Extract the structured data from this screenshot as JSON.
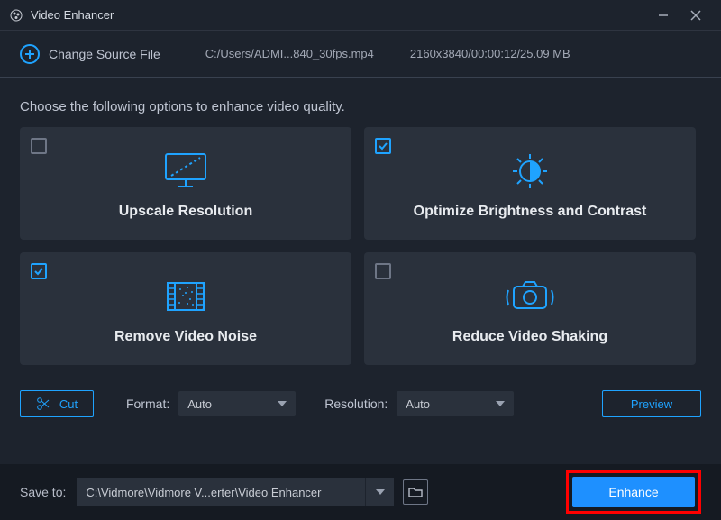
{
  "titlebar": {
    "title": "Video Enhancer"
  },
  "source": {
    "change_label": "Change Source File",
    "file_path": "C:/Users/ADMI...840_30fps.mp4",
    "file_spec": "2160x3840/00:00:12/25.09 MB"
  },
  "prompt": "Choose the following options to enhance video quality.",
  "cards": {
    "upscale": {
      "label": "Upscale Resolution",
      "checked": false
    },
    "brightness": {
      "label": "Optimize Brightness and Contrast",
      "checked": true
    },
    "noise": {
      "label": "Remove Video Noise",
      "checked": true
    },
    "shaking": {
      "label": "Reduce Video Shaking",
      "checked": false
    }
  },
  "controls": {
    "cut_label": "Cut",
    "format_label": "Format:",
    "format_value": "Auto",
    "resolution_label": "Resolution:",
    "resolution_value": "Auto",
    "preview_label": "Preview"
  },
  "footer": {
    "save_to_label": "Save to:",
    "save_path": "C:\\Vidmore\\Vidmore V...erter\\Video Enhancer",
    "enhance_label": "Enhance"
  }
}
